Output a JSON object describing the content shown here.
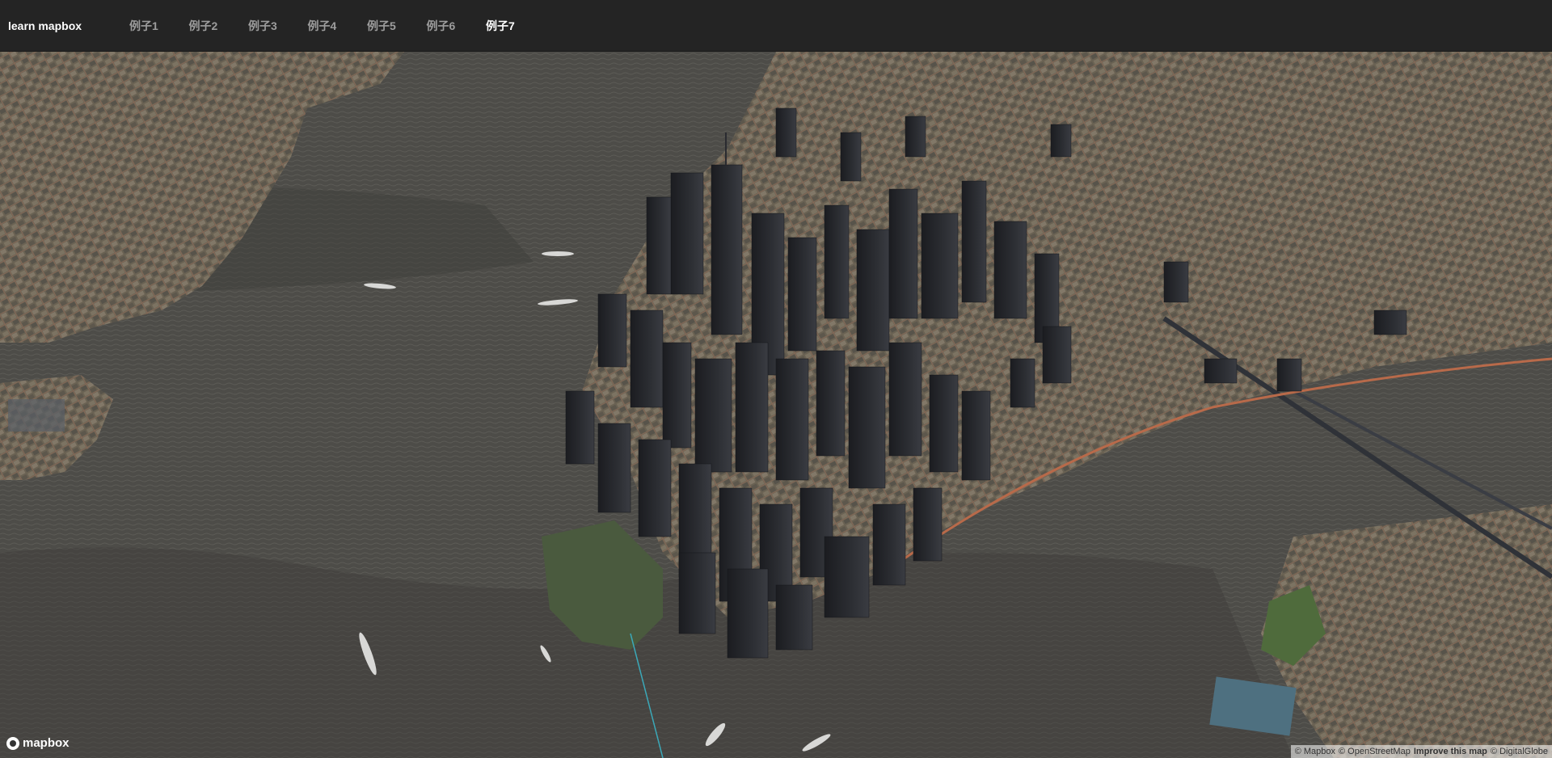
{
  "header": {
    "brand": "learn mapbox",
    "nav": [
      {
        "label": "例子1",
        "active": false
      },
      {
        "label": "例子2",
        "active": false
      },
      {
        "label": "例子3",
        "active": false
      },
      {
        "label": "例子4",
        "active": false
      },
      {
        "label": "例子5",
        "active": false
      },
      {
        "label": "例子6",
        "active": false
      },
      {
        "label": "例子7",
        "active": true
      }
    ]
  },
  "map": {
    "logo_text": "mapbox",
    "attribution": {
      "mapbox": "© Mapbox",
      "osm": "© OpenStreetMap",
      "improve": "Improve this map",
      "digitalglobe": "© DigitalGlobe"
    }
  },
  "colors": {
    "header_bg": "#242424",
    "nav_inactive": "#9d9d9d",
    "nav_active": "#ffffff",
    "water": "#4a4946",
    "land": "#6b6455"
  }
}
